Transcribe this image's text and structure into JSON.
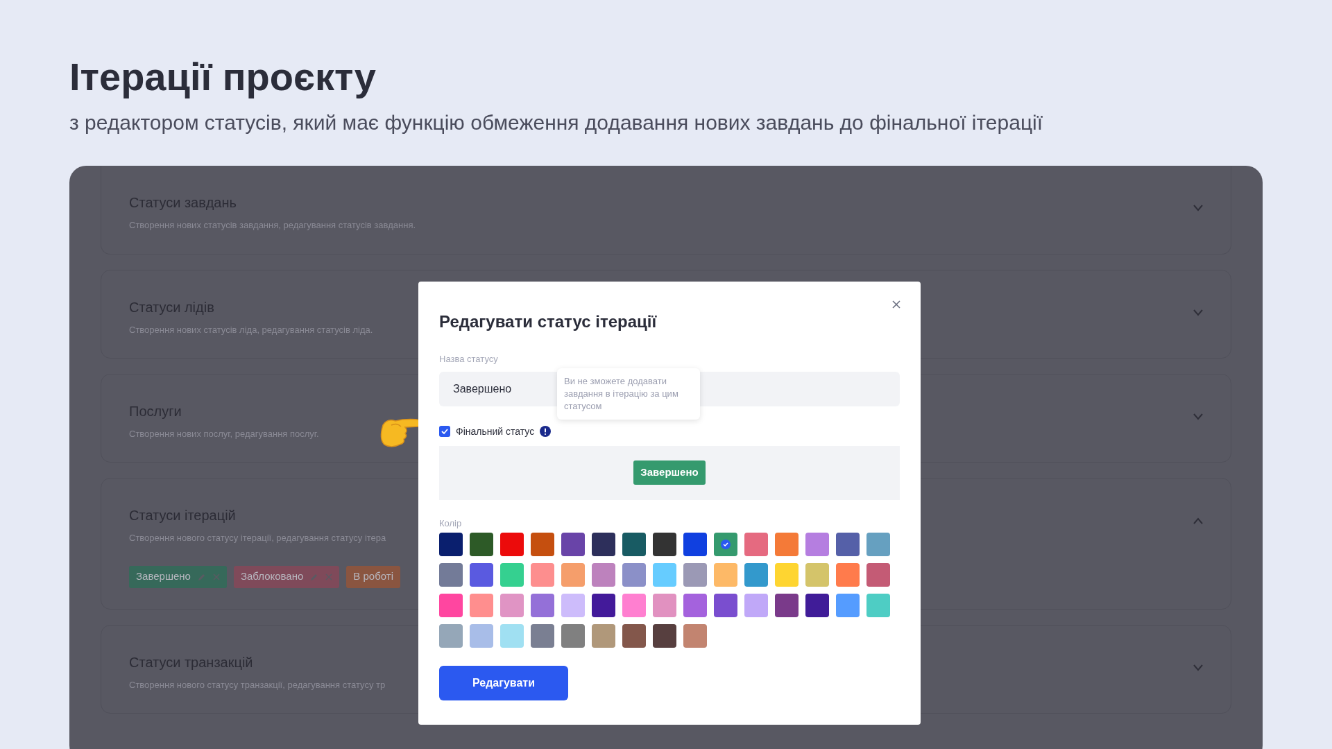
{
  "header": {
    "title": "Ітерації проєкту",
    "subtitle": "з редактором статусів, який має функцію обмеження додавання нових завдань до фінальної ітерації"
  },
  "sections": [
    {
      "title": "Статуси завдань",
      "description": "Створення нових статусів завдання, редагування статусів завдання.",
      "expanded": false
    },
    {
      "title": "Статуси лідів",
      "description": "Створення нових статусів ліда, редагування статусів ліда.",
      "expanded": false
    },
    {
      "title": "Послуги",
      "description": "Створення нових послуг, редагування послуг.",
      "expanded": false
    },
    {
      "title": "Статуси ітерацій",
      "description": "Створення нового статусу ітерації, редагування статусу ітера",
      "expanded": true,
      "tags": [
        {
          "label": "Завершено",
          "color": "#36695a"
        },
        {
          "label": "Заблоковано",
          "color": "#7f4a5a"
        },
        {
          "label": "В роботі",
          "color": "#8a5540"
        }
      ]
    },
    {
      "title": "Статуси транзакцій",
      "description": "Створення нового статусу транзакції, редагування статусу тр",
      "expanded": false
    }
  ],
  "modal": {
    "title": "Редагувати статус ітерації",
    "name_label": "Назва статусу",
    "name_value": "Завершено",
    "tooltip": "Ви не зможете додавати завдання в ітерацію за цим статусом",
    "final_status": {
      "label": "Фінальний статус",
      "checked": true
    },
    "preview": {
      "label": "Завершено",
      "color": "#359a6e"
    },
    "color_label": "Колір",
    "colors": [
      {
        "color": "#0a1f6e",
        "selected": false
      },
      {
        "color": "#2d5a27",
        "selected": false
      },
      {
        "color": "#ec0b0b",
        "selected": false
      },
      {
        "color": "#c54f0f",
        "selected": false
      },
      {
        "color": "#6944a8",
        "selected": false
      },
      {
        "color": "#2d2f5b",
        "selected": false
      },
      {
        "color": "#185b63",
        "selected": false
      },
      {
        "color": "#333333",
        "selected": false
      },
      {
        "color": "#1040e0",
        "selected": false
      },
      {
        "color": "#359a6e",
        "selected": true
      },
      {
        "color": "#e56a80",
        "selected": false
      },
      {
        "color": "#f47a38",
        "selected": false
      },
      {
        "color": "#b57ee0",
        "selected": false
      },
      {
        "color": "#5560a8",
        "selected": false
      },
      {
        "color": "#66a0c0",
        "selected": false
      },
      {
        "color": "#737b98",
        "selected": false
      },
      {
        "color": "#5a5ae0",
        "selected": false
      },
      {
        "color": "#35d090",
        "selected": false
      },
      {
        "color": "#fd8e8e",
        "selected": false
      },
      {
        "color": "#f59e6b",
        "selected": false
      },
      {
        "color": "#bd82bd",
        "selected": false
      },
      {
        "color": "#8b90c8",
        "selected": false
      },
      {
        "color": "#66ccff",
        "selected": false
      },
      {
        "color": "#9b99b5",
        "selected": false
      },
      {
        "color": "#fdb967",
        "selected": false
      },
      {
        "color": "#3399cc",
        "selected": false
      },
      {
        "color": "#fed531",
        "selected": false
      },
      {
        "color": "#d4c46a",
        "selected": false
      },
      {
        "color": "#ff7b4c",
        "selected": false
      },
      {
        "color": "#c45b75",
        "selected": false
      },
      {
        "color": "#ff46a0",
        "selected": false
      },
      {
        "color": "#ff8e8e",
        "selected": false
      },
      {
        "color": "#e094c4",
        "selected": false
      },
      {
        "color": "#9470d8",
        "selected": false
      },
      {
        "color": "#cdbcfb",
        "selected": false
      },
      {
        "color": "#431a9a",
        "selected": false
      },
      {
        "color": "#ff7fd0",
        "selected": false
      },
      {
        "color": "#e191c0",
        "selected": false
      },
      {
        "color": "#a462dd",
        "selected": false
      },
      {
        "color": "#7a4ecf",
        "selected": false
      },
      {
        "color": "#c0a8f8",
        "selected": false
      },
      {
        "color": "#7a3a8a",
        "selected": false
      },
      {
        "color": "#401c98",
        "selected": false
      },
      {
        "color": "#559cff",
        "selected": false
      },
      {
        "color": "#4ecdc4",
        "selected": false
      },
      {
        "color": "#95a7b8",
        "selected": false
      },
      {
        "color": "#a8bde8",
        "selected": false
      },
      {
        "color": "#a0e0f2",
        "selected": false
      },
      {
        "color": "#7a7f92",
        "selected": false
      },
      {
        "color": "#808080",
        "selected": false
      },
      {
        "color": "#b0987a",
        "selected": false
      },
      {
        "color": "#83574b",
        "selected": false
      },
      {
        "color": "#573f3f",
        "selected": false
      },
      {
        "color": "#c28470",
        "selected": false
      }
    ],
    "submit": "Редагувати"
  }
}
